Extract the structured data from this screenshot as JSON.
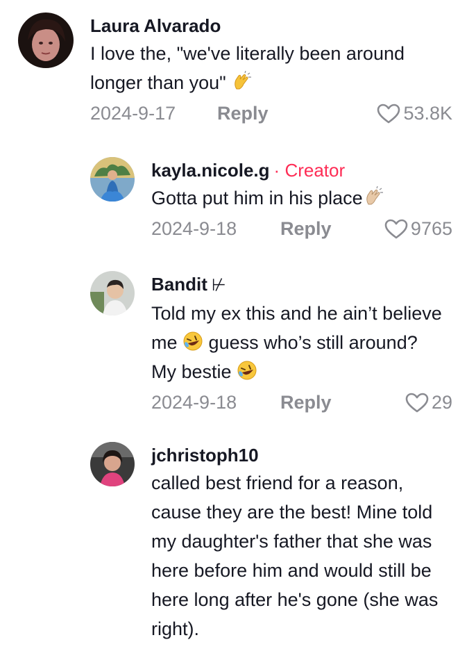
{
  "comments": [
    {
      "username": "Laura Alvarado",
      "text": "I love the, \"we've literally been around longer than you\"",
      "emoji": "clapping-hands",
      "date": "2024-9-17",
      "reply_label": "Reply",
      "likes": "53.8K"
    },
    {
      "username": "kayla.nicole.g",
      "creator_separator": "·",
      "creator_label": "Creator",
      "text": "Gotta put him in his place",
      "emoji": "clapping-hands-light-skin",
      "date": "2024-9-18",
      "reply_label": "Reply",
      "likes": "9765"
    },
    {
      "username": "Bandit",
      "username_glyph": "⊬",
      "text_part1": "Told my ex this and he ain’t believe me",
      "text_part2": "guess who’s still around? My bestie",
      "emoji": "rolling-on-floor-laughing",
      "date": "2024-9-18",
      "reply_label": "Reply",
      "likes": "29"
    },
    {
      "username": "jchristoph10",
      "text": "called best friend for a reason, cause they are the best! Mine told my daughter's father that she was here before him and would still be here long after he's gone (she was right)."
    }
  ],
  "colors": {
    "text": "#161823",
    "muted": "#8a8b91",
    "creator": "#fe2c55"
  }
}
